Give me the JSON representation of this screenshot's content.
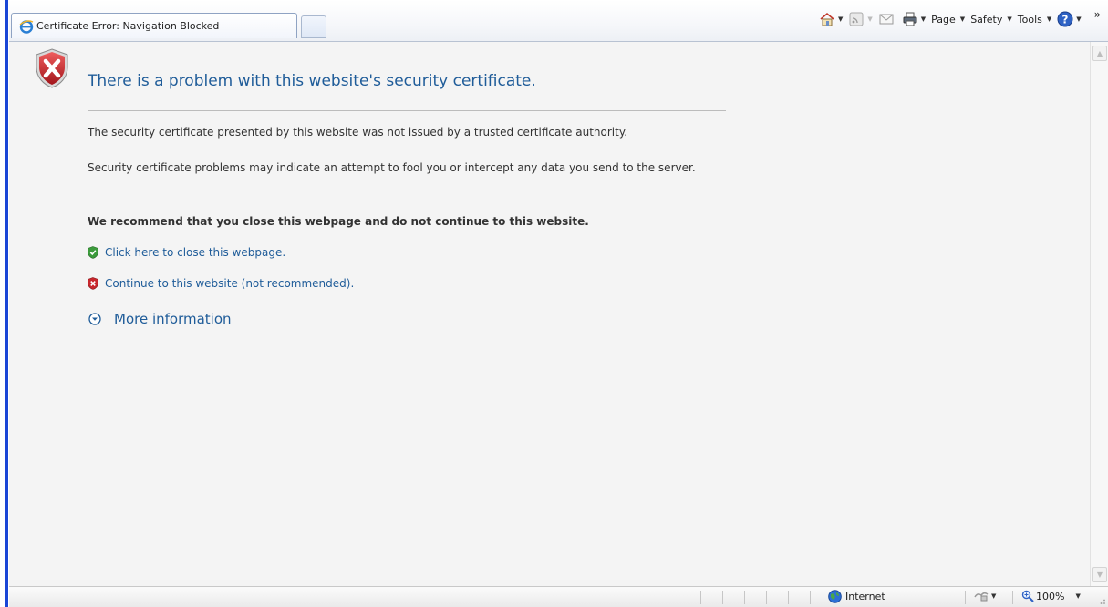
{
  "tab": {
    "title": "Certificate Error: Navigation Blocked",
    "icon": "ie-icon"
  },
  "commandbar": {
    "page_label": "Page",
    "safety_label": "Safety",
    "tools_label": "Tools",
    "overflow": "»"
  },
  "page": {
    "heading": "There is a problem with this website's security certificate.",
    "paragraph1": "The security certificate presented by this website was not issued by a trusted certificate authority.",
    "paragraph2": "Security certificate problems may indicate an attempt to fool you or intercept any data you send to the server.",
    "recommendation": "We recommend that you close this webpage and do not continue to this website.",
    "close_link": "Click here to close this webpage.",
    "continue_link": "Continue to this website (not recommended).",
    "more_info": "More information"
  },
  "statusbar": {
    "zone": "Internet",
    "zoom": "100%"
  },
  "colors": {
    "link": "#1f5c99",
    "body_text": "#333333",
    "page_bg": "#f4f4f4",
    "error_red": "#c8262c",
    "ok_green": "#3b9b3b"
  }
}
